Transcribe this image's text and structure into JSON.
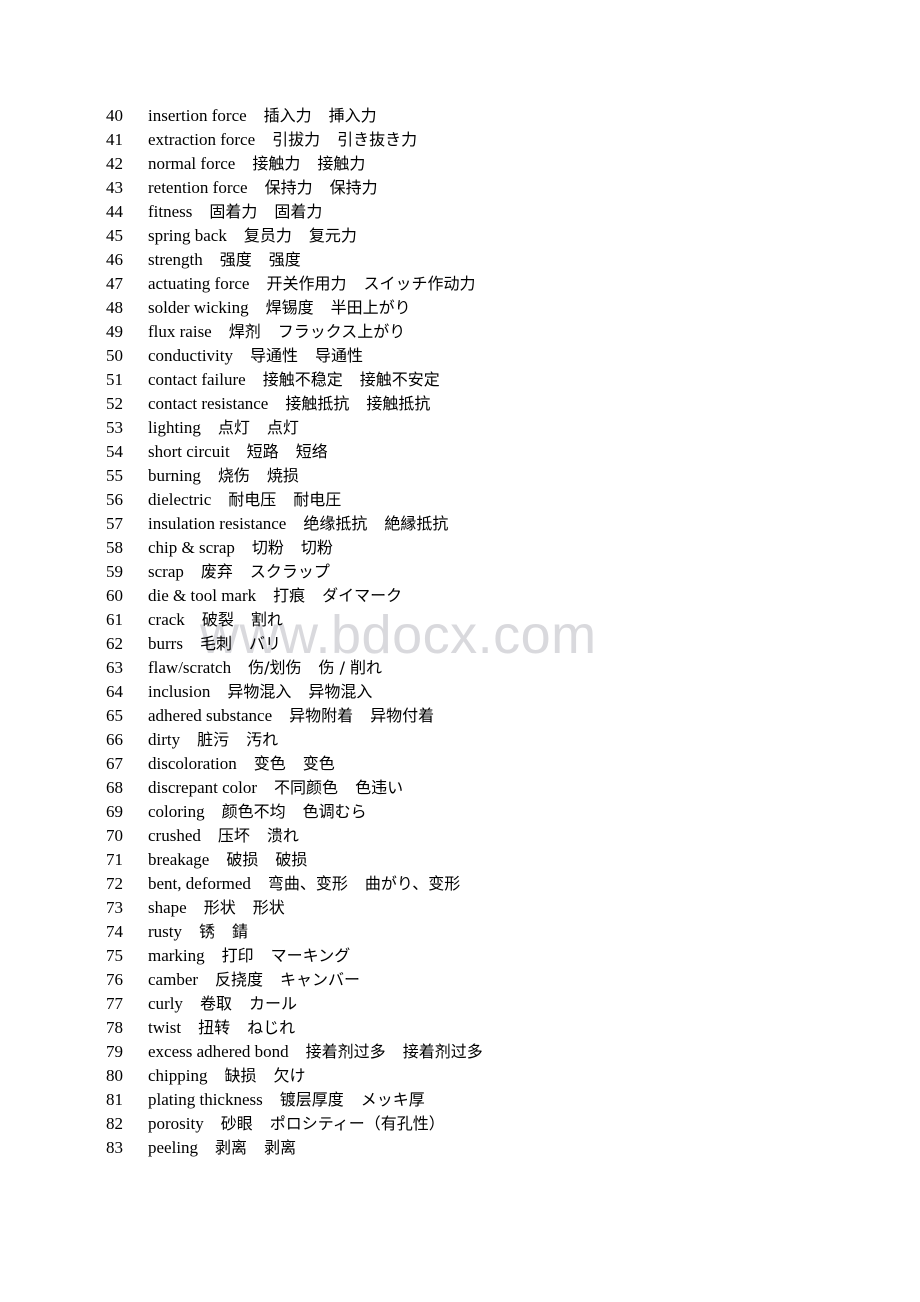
{
  "document": {
    "type": "trilingual-glossary-table",
    "watermark": "www.bdocx.com",
    "watermark_color": "#d9d9dd",
    "page_background": "#ffffff",
    "text_color": "#000000",
    "columns": [
      "number",
      "english",
      "chinese",
      "japanese"
    ]
  },
  "entries": [
    {
      "num": "40",
      "en": "insertion force",
      "cn": "插入力",
      "jp": "挿入力"
    },
    {
      "num": "41",
      "en": "extraction force",
      "cn": "引拔力",
      "jp": "引き抜き力"
    },
    {
      "num": "42",
      "en": "normal force",
      "cn": "接触力",
      "jp": "接触力"
    },
    {
      "num": "43",
      "en": "retention force",
      "cn": "保持力",
      "jp": "保持力"
    },
    {
      "num": "44",
      "en": "fitness",
      "cn": "固着力",
      "jp": "固着力"
    },
    {
      "num": "45",
      "en": "spring back",
      "cn": "复员力",
      "jp": "复元力"
    },
    {
      "num": "46",
      "en": "strength",
      "cn": "强度",
      "jp": "强度"
    },
    {
      "num": "47",
      "en": "actuating force",
      "cn": "开关作用力",
      "jp": "スイッチ作动力"
    },
    {
      "num": "48",
      "en": "solder wicking",
      "cn": "焊锡度",
      "jp": "半田上がり"
    },
    {
      "num": "49",
      "en": "flux raise",
      "cn": "焊剂",
      "jp": "フラックス上がり"
    },
    {
      "num": "50",
      "en": "conductivity",
      "cn": "导通性",
      "jp": "导通性"
    },
    {
      "num": "51",
      "en": "contact failure",
      "cn": "接触不稳定",
      "jp": "接触不安定"
    },
    {
      "num": "52",
      "en": "contact resistance",
      "cn": "接触抵抗",
      "jp": "接触抵抗"
    },
    {
      "num": "53",
      "en": "lighting",
      "cn": "点灯",
      "jp": "点灯"
    },
    {
      "num": "54",
      "en": "short circuit",
      "cn": "短路",
      "jp": "短络"
    },
    {
      "num": "55",
      "en": "burning",
      "cn": "烧伤",
      "jp": "焼损"
    },
    {
      "num": "56",
      "en": "dielectric",
      "cn": "耐电压",
      "jp": "耐电圧"
    },
    {
      "num": "57",
      "en": "insulation resistance",
      "cn": "绝缘抵抗",
      "jp": "絶縁抵抗"
    },
    {
      "num": "58",
      "en": "chip & scrap",
      "cn": "切粉",
      "jp": "切粉"
    },
    {
      "num": "59",
      "en": "scrap",
      "cn": "废弃",
      "jp": "スクラップ"
    },
    {
      "num": "60",
      "en": "die & tool mark",
      "cn": "打痕",
      "jp": "ダイマーク"
    },
    {
      "num": "61",
      "en": "crack",
      "cn": "破裂",
      "jp": "割れ"
    },
    {
      "num": "62",
      "en": "burrs",
      "cn": "毛刺",
      "jp": "バリ"
    },
    {
      "num": "63",
      "en": "flaw/scratch",
      "cn": "伤/划伤",
      "jp": "伤 / 削れ"
    },
    {
      "num": "64",
      "en": "inclusion",
      "cn": "异物混入",
      "jp": "异物混入"
    },
    {
      "num": "65",
      "en": "adhered substance",
      "cn": "异物附着",
      "jp": "异物付着"
    },
    {
      "num": "66",
      "en": "dirty",
      "cn": "脏污",
      "jp": "汚れ"
    },
    {
      "num": "67",
      "en": "discoloration",
      "cn": "变色",
      "jp": "变色"
    },
    {
      "num": "68",
      "en": "discrepant color",
      "cn": "不同颜色",
      "jp": "色违い"
    },
    {
      "num": "69",
      "en": "coloring",
      "cn": "颜色不均",
      "jp": "色调むら"
    },
    {
      "num": "70",
      "en": "crushed",
      "cn": "压坏",
      "jp": "溃れ"
    },
    {
      "num": "71",
      "en": "breakage",
      "cn": "破损",
      "jp": "破损"
    },
    {
      "num": "72",
      "en": "bent, deformed",
      "cn": "弯曲、变形",
      "jp": "曲がり、变形"
    },
    {
      "num": "73",
      "en": "shape",
      "cn": "形状",
      "jp": "形状"
    },
    {
      "num": "74",
      "en": "rusty",
      "cn": "锈",
      "jp": "錆"
    },
    {
      "num": "75",
      "en": "marking",
      "cn": "打印",
      "jp": "マーキング"
    },
    {
      "num": "76",
      "en": "camber",
      "cn": "反挠度",
      "jp": "キャンバー"
    },
    {
      "num": "77",
      "en": "curly",
      "cn": "卷取",
      "jp": "カール"
    },
    {
      "num": "78",
      "en": "twist",
      "cn": "扭转",
      "jp": "ねじれ"
    },
    {
      "num": "79",
      "en": "excess adhered bond",
      "cn": "接着剂过多",
      "jp": "接着剂过多"
    },
    {
      "num": "80",
      "en": "chipping",
      "cn": "缺损",
      "jp": "欠け"
    },
    {
      "num": "81",
      "en": "plating thickness",
      "cn": "镀层厚度",
      "jp": "メッキ厚"
    },
    {
      "num": "82",
      "en": "porosity",
      "cn": "砂眼",
      "jp": "ポロシティー（有孔性）"
    },
    {
      "num": "83",
      "en": "peeling",
      "cn": "剥离",
      "jp": "剥离"
    }
  ]
}
